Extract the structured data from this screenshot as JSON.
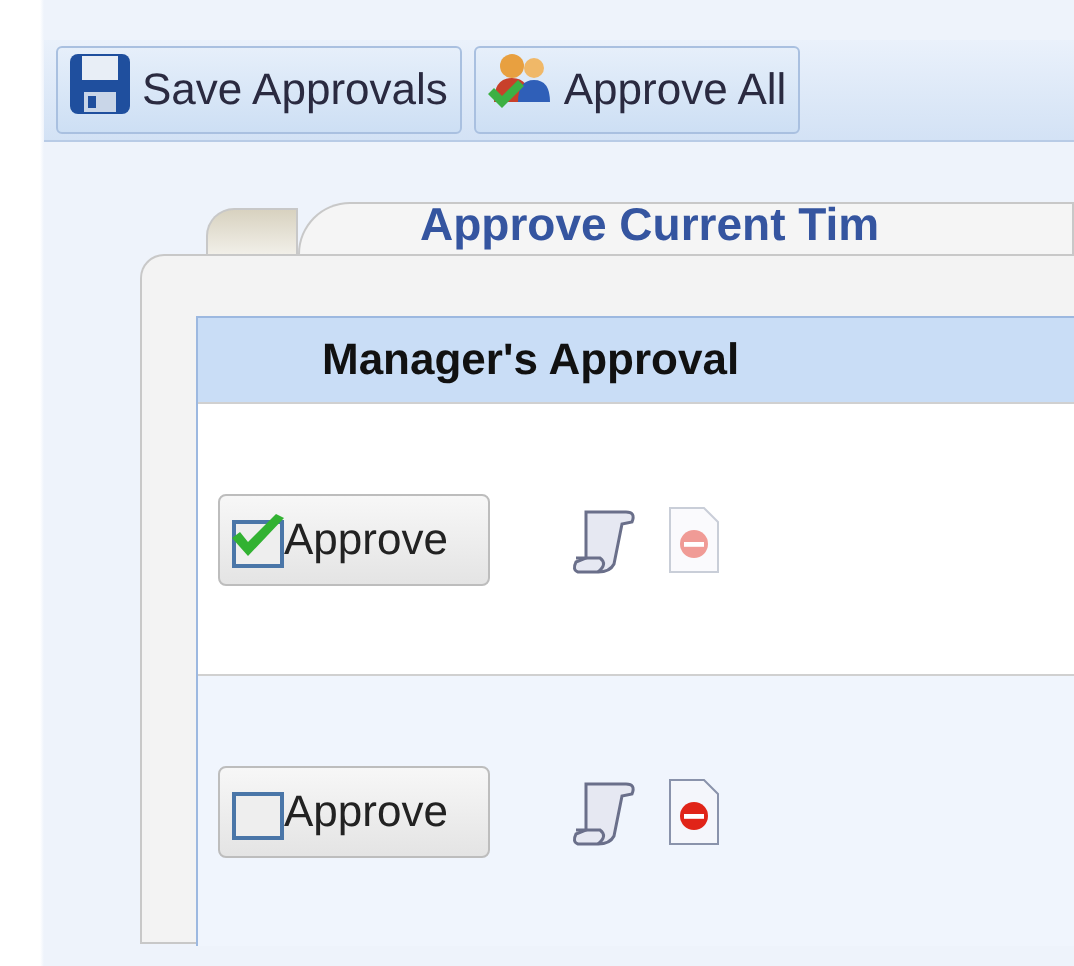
{
  "toolbar": {
    "buttons": [
      {
        "label": "Save Approvals",
        "kind": "save"
      },
      {
        "label": "Approve All",
        "kind": "approve_all"
      }
    ]
  },
  "panel": {
    "tab_title": "Approve Current Tim",
    "column_header": "Manager's Approval",
    "rows": [
      {
        "label": "Approve",
        "checked": true,
        "reject_disabled": true
      },
      {
        "label": "Approve",
        "checked": false,
        "reject_disabled": false
      }
    ]
  }
}
